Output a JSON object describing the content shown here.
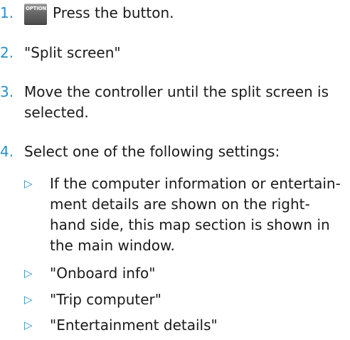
{
  "steps": [
    {
      "number": "1.",
      "text": "Press the button.",
      "icon": "option-button-icon",
      "icon_label": "OPTION"
    },
    {
      "number": "2.",
      "text": "\"Split screen\""
    },
    {
      "number": "3.",
      "text_lines": [
        "Move the controller until the split screen is",
        "selected."
      ]
    },
    {
      "number": "4.",
      "text": "Select one of the following settings:"
    }
  ],
  "sub_items": [
    {
      "bullet": "▷",
      "lines": [
        "If the computer information or entertain-",
        "ment details are shown on the right-",
        "hand side, this map section is shown in",
        "the main window."
      ]
    },
    {
      "bullet": "▷",
      "text": "\"Onboard info\""
    },
    {
      "bullet": "▷",
      "text": "\"Trip computer\""
    },
    {
      "bullet": "▷",
      "text": "\"Entertainment details\""
    }
  ],
  "colors": {
    "accent": "#2a8fc4",
    "text": "#1a1a1a"
  }
}
